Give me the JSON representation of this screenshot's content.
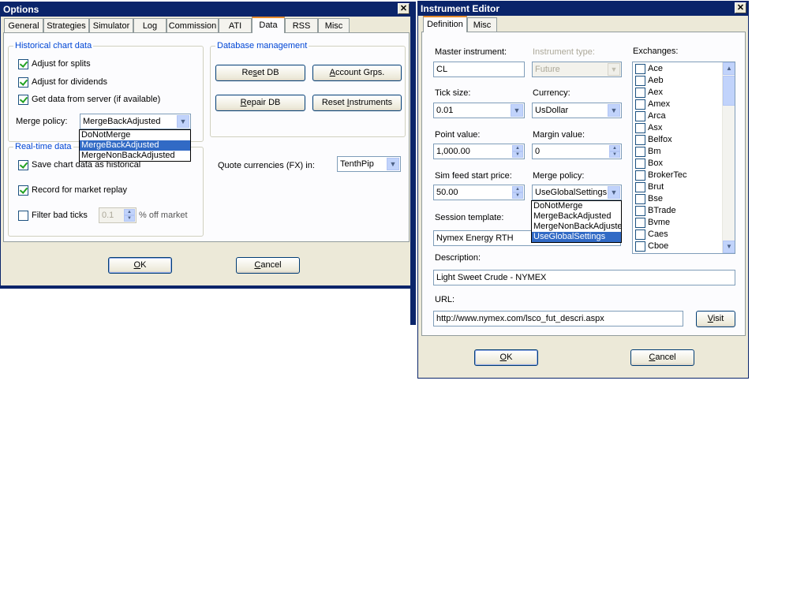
{
  "options_window": {
    "title": "Options",
    "tabs": [
      {
        "label": "General"
      },
      {
        "label": "Strategies"
      },
      {
        "label": "Simulator"
      },
      {
        "label": "Log"
      },
      {
        "label": "Commission"
      },
      {
        "label": "ATI"
      },
      {
        "label": "Data"
      },
      {
        "label": "RSS"
      },
      {
        "label": "Misc"
      }
    ],
    "active_tab": "Data",
    "historical": {
      "legend": "Historical chart data",
      "adjust_splits": {
        "label": "Adjust for splits",
        "checked": true
      },
      "adjust_dividends": {
        "label": "Adjust for dividends",
        "checked": true
      },
      "get_data_server": {
        "label": "Get data from server (if available)",
        "checked": true
      },
      "merge_policy_label": "Merge policy:",
      "merge_policy_value": "MergeBackAdjusted",
      "merge_options": [
        "DoNotMerge",
        "MergeBackAdjusted",
        "MergeNonBackAdjusted"
      ],
      "merge_selected": "MergeBackAdjusted"
    },
    "realtime": {
      "legend": "Real-time data",
      "save_chart": {
        "label": "Save chart data as historical",
        "checked": true
      },
      "record_replay": {
        "label": "Record for market replay",
        "checked": true
      },
      "filter_bad_ticks": {
        "label": "Filter bad ticks",
        "checked": false
      },
      "filter_value": "0.1",
      "off_market_label": "% off market"
    },
    "database": {
      "legend": "Database management",
      "reset_db_pre": "Re",
      "reset_db_mn": "s",
      "reset_db_post": "et DB",
      "account_grps_pre": "",
      "account_grps_mn": "A",
      "account_grps_post": "ccount Grps.",
      "repair_db_pre": "",
      "repair_db_mn": "R",
      "repair_db_post": "epair DB",
      "reset_instr_pre": "Reset ",
      "reset_instr_mn": "I",
      "reset_instr_post": "nstruments"
    },
    "quote_currencies_label": "Quote currencies (FX) in:",
    "quote_currencies_value": "TenthPip",
    "ok_mn": "O",
    "ok_post": "K",
    "cancel_mn": "C",
    "cancel_post": "ancel"
  },
  "instrument_editor": {
    "title": "Instrument Editor",
    "tabs": [
      {
        "label": "Definition"
      },
      {
        "label": "Misc"
      }
    ],
    "master_instrument_label": "Master instrument:",
    "master_instrument_value": "CL",
    "instrument_type_label": "Instrument type:",
    "instrument_type_value": "Future",
    "tick_size_label": "Tick size:",
    "tick_size_value": "0.01",
    "currency_label": "Currency:",
    "currency_value": "UsDollar",
    "point_value_label": "Point value:",
    "point_value_value": "1,000.00",
    "margin_value_label": "Margin value:",
    "margin_value_value": "0",
    "sim_feed_label": "Sim feed start price:",
    "sim_feed_value": "50.00",
    "merge_policy_label": "Merge policy:",
    "merge_policy_value": "UseGlobalSettings",
    "merge_options": [
      "DoNotMerge",
      "MergeBackAdjusted",
      "MergeNonBackAdjuste",
      "UseGlobalSettings"
    ],
    "merge_selected": "UseGlobalSettings",
    "session_template_label": "Session template:",
    "session_template_value": "Nymex Energy RTH",
    "exchanges_label": "Exchanges:",
    "exchanges": [
      "Ace",
      "Aeb",
      "Aex",
      "Amex",
      "Arca",
      "Asx",
      "Belfox",
      "Bm",
      "Box",
      "BrokerTec",
      "Brut",
      "Bse",
      "BTrade",
      "Bvme",
      "Caes",
      "Cboe"
    ],
    "description_label": "Description:",
    "description_value": "Light Sweet Crude - NYMEX",
    "url_label": "URL:",
    "url_value": "http://www.nymex.com/lsco_fut_descri.aspx",
    "visit_mn": "V",
    "visit_post": "isit",
    "ok_mn": "O",
    "ok_post": "K",
    "cancel_mn": "C",
    "cancel_post": "ancel"
  }
}
